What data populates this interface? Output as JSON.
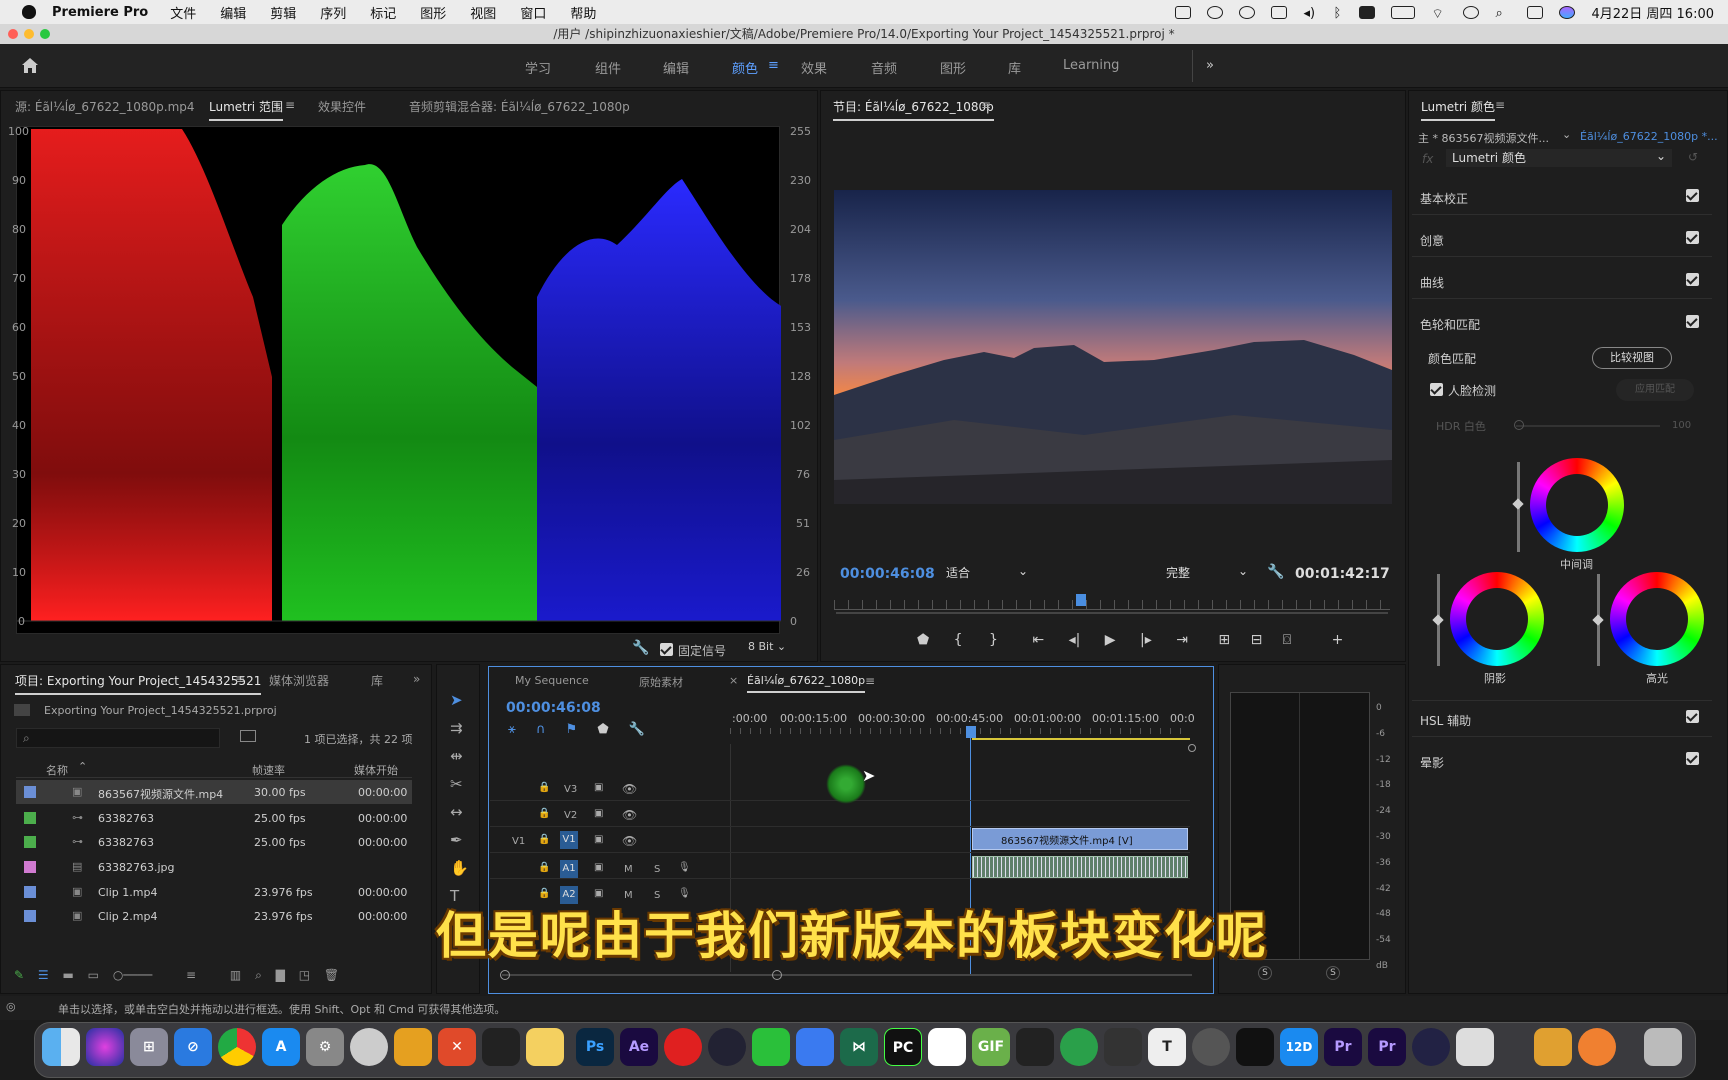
{
  "menubar": {
    "app_name": "Premiere Pro",
    "items": [
      "文件",
      "编辑",
      "剪辑",
      "序列",
      "标记",
      "图形",
      "视图",
      "窗口",
      "帮助"
    ],
    "datetime": "4月22日 周四  16:00"
  },
  "window": {
    "title": "/用户 /shipinzhizuonaxieshier/文稿/Adobe/Premiere Pro/14.0/Exporting Your Project_1454325521.prproj *"
  },
  "workspaces": {
    "items": [
      "学习",
      "组件",
      "编辑",
      "颜色",
      "效果",
      "音频",
      "图形",
      "库",
      "Learning"
    ],
    "active": "颜色",
    "more": "»"
  },
  "source_panel": {
    "tabs": [
      "源: Éãl¼ĺø_67622_1080p.mp4",
      "Lumetri 范围",
      "效果控件",
      "音频剪辑混合器: Éãl¼ĺø_67622_1080p"
    ],
    "active_tab": "Lumetri 范围",
    "scope_left_axis": [
      "100",
      "90",
      "80",
      "70",
      "60",
      "50",
      "40",
      "30",
      "20",
      "10",
      "0"
    ],
    "scope_right_axis": [
      "255",
      "230",
      "204",
      "178",
      "153",
      "128",
      "102",
      "76",
      "51",
      "26",
      "0"
    ],
    "clamp_signal_label": "固定信号",
    "bit_depth": "8 Bit"
  },
  "program_panel": {
    "title": "节目: Éãl¼ĺø_67622_1080p",
    "timecode": "00:00:46:08",
    "fit": "适合",
    "quality": "完整",
    "duration": "00:01:42:17"
  },
  "lumetri_panel": {
    "title": "Lumetri 颜色",
    "master_clip": "主 * 863567视频源文件...",
    "sequence_clip": "Éãl¼ĺø_67622_1080p *...",
    "fx_label": "fx",
    "effect_name": "Lumetri 颜色",
    "sections": [
      "基本校正",
      "创意",
      "曲线",
      "色轮和匹配"
    ],
    "color_match": "颜色匹配",
    "compare_view": "比较视图",
    "face_detect": "人脸检测",
    "apply_match": "应用匹配",
    "hdr_white": "HDR 白色",
    "hdr_value": "100",
    "wheel_mid": "中间调",
    "wheel_shadow": "阴影",
    "wheel_highlight": "高光",
    "hsl": "HSL 辅助",
    "vignette": "晕影"
  },
  "project_panel": {
    "tabs": [
      "项目: Exporting Your Project_1454325521",
      "媒体浏览器",
      "库"
    ],
    "file": "Exporting Your Project_1454325521.prproj",
    "selection_info": "1 项已选择，共 22 项",
    "columns": [
      "名称",
      "帧速率",
      "媒体开始"
    ],
    "rows": [
      {
        "name": "863567视频源文件.mp4",
        "fps": "30.00 fps",
        "start": "00:00:00",
        "color": "#6b8fd6"
      },
      {
        "name": "63382763",
        "fps": "25.00 fps",
        "start": "00:00:00",
        "color": "#4cae4c"
      },
      {
        "name": "63382763",
        "fps": "25.00 fps",
        "start": "00:00:00",
        "color": "#4cae4c"
      },
      {
        "name": "63382763.jpg",
        "fps": "",
        "start": "",
        "color": "#d07ad0"
      },
      {
        "name": "Clip 1.mp4",
        "fps": "23.976 fps",
        "start": "00:00:00",
        "color": "#6b8fd6"
      },
      {
        "name": "Clip 2.mp4",
        "fps": "23.976 fps",
        "start": "00:00:00",
        "color": "#6b8fd6"
      }
    ]
  },
  "timeline": {
    "tabs": [
      "My Sequence",
      "原始素材",
      "Éãl¼ĺø_67622_1080p"
    ],
    "timecode": "00:00:46:08",
    "ruler": [
      ":00:00",
      "00:00:15:00",
      "00:00:30:00",
      "00:00:45:00",
      "00:01:00:00",
      "00:01:15:00",
      "00:0"
    ],
    "tracks": {
      "v3": "V3",
      "v2": "V2",
      "v1": "V1",
      "v1_src": "V1",
      "a1": "A1",
      "a2": "A2",
      "m": "M",
      "s": "S"
    },
    "clip_label": "863567视频源文件.mp4 [V]"
  },
  "audio_meter": {
    "ticks": [
      "0",
      "-6",
      "-12",
      "-18",
      "-24",
      "-30",
      "-36",
      "-42",
      "-48",
      "-54",
      "dB"
    ],
    "solo": "S"
  },
  "status_bar": "单击以选择，或单击空白处并拖动以进行框选。使用 Shift、Opt 和 Cmd 可获得其他选项。",
  "subtitle": "但是呢由于我们新版本的板块变化呢",
  "dock": [
    "Finder",
    "Siri",
    "Launchpad",
    "Safari",
    "Chrome",
    "App Store",
    "系统偏好设置",
    "QuickTime",
    "Pineapple",
    "XMind",
    "QQ",
    "Notes",
    "Ps",
    "Ae",
    "网易云音乐",
    "Cinema 4D",
    "微信",
    "飞书",
    "VS",
    "PC",
    "百度网盘",
    "GIF",
    "Screen",
    "Evernote",
    "Terminal",
    "T",
    "DaVinci",
    "CapCut",
    "12D tv",
    "Pr",
    "Pr",
    "Safari Tech",
    "录屏",
    "Downloads",
    "Trash"
  ]
}
